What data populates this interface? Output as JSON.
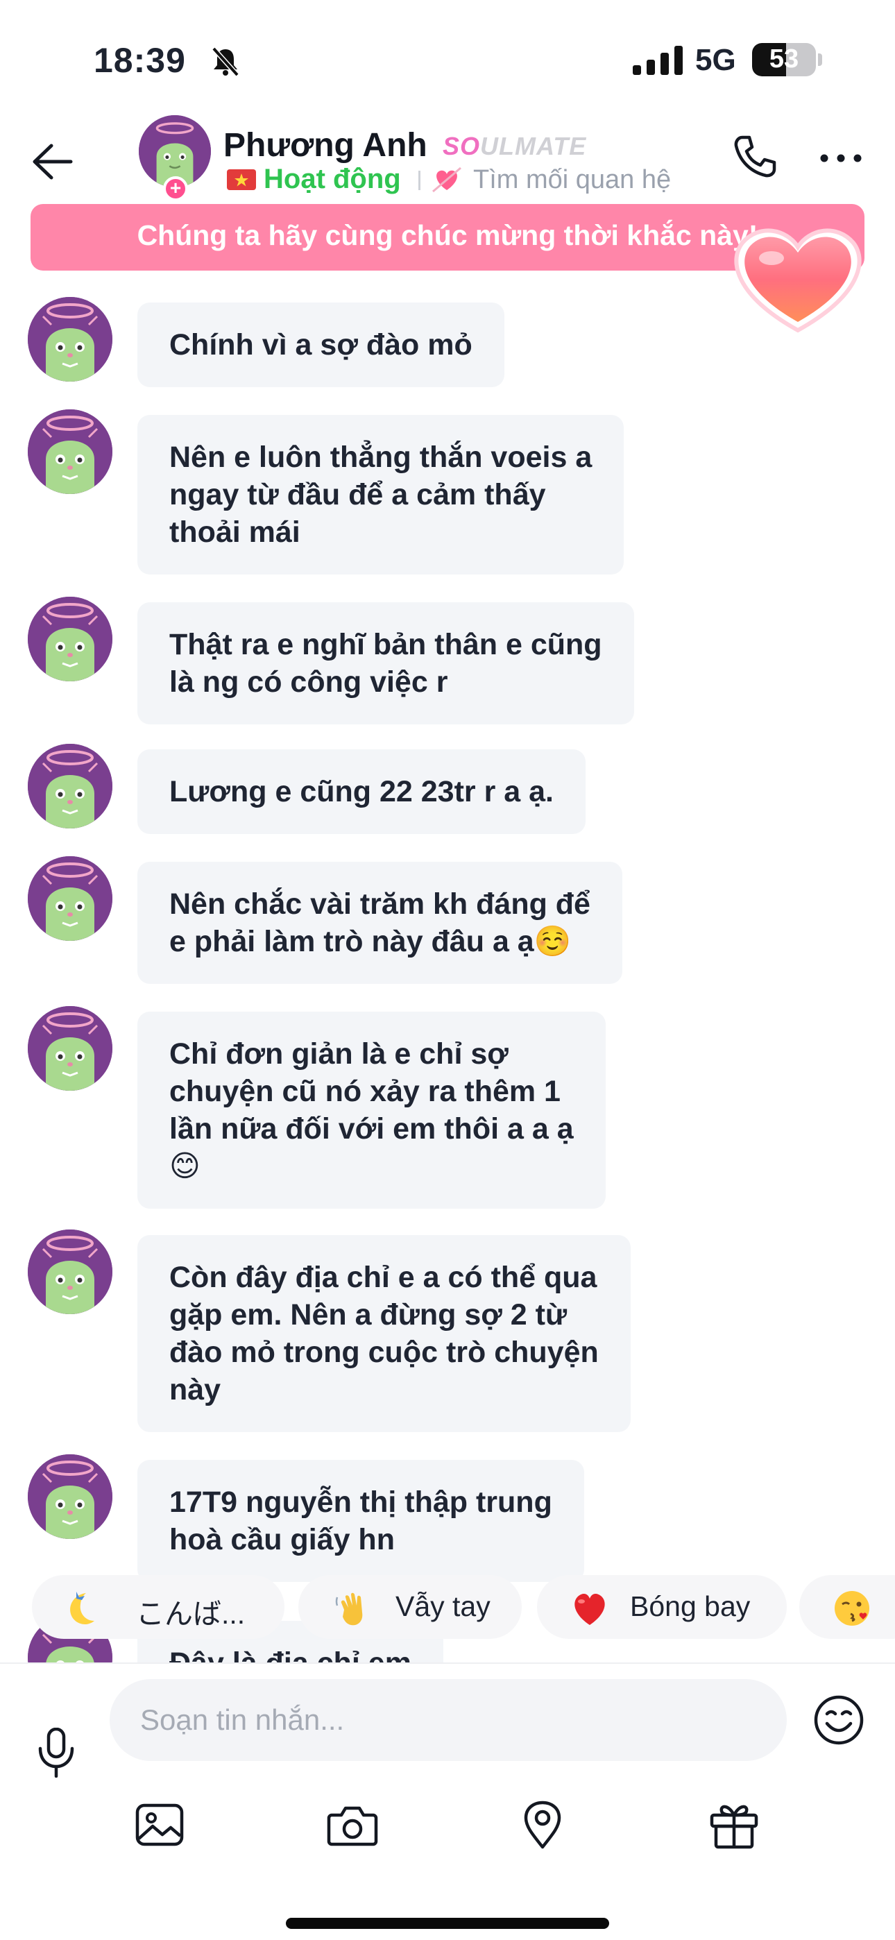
{
  "status_bar": {
    "time": "18:39",
    "network": "5G",
    "battery": "53",
    "battery_level": 0.53
  },
  "header": {
    "contact_name": "Phương Anh",
    "badge_prefix": "SO",
    "badge_suffix": "ULMATE",
    "online_status": "Hoạt động",
    "relationship_goal": "Tìm mối quan hệ"
  },
  "banner": {
    "text": "Chúng ta hãy cùng chúc mừng thời khắc này!"
  },
  "messages": [
    {
      "lines": [
        "Chính vì a sợ đào mỏ"
      ]
    },
    {
      "lines": [
        "Nên e luôn thẳng thắn voeis a",
        "ngay từ đầu để a cảm thấy",
        "thoải mái"
      ]
    },
    {
      "lines": [
        "Thật ra e nghĩ bản thân e cũng",
        "là ng có công việc r"
      ]
    },
    {
      "lines": [
        "Lương e cũng 22 23tr r a ạ."
      ]
    },
    {
      "lines": [
        "Nên chắc vài trăm kh đáng để",
        "e phải làm trò này đâu a ạ☺️"
      ]
    },
    {
      "lines": [
        "Chỉ đơn giản là e chỉ sợ",
        "chuyện cũ nó xảy ra thêm 1",
        "lần nữa đối với em thôi a a ạ",
        "😊"
      ]
    },
    {
      "lines": [
        "Còn đây địa chỉ e a có thể qua",
        "gặp em. Nên a đừng sợ 2 từ",
        "đào mỏ trong cuộc trò chuyện",
        "này"
      ]
    },
    {
      "lines": [
        "17T9 nguyễn thị thập trung",
        "hoà cầu giấy hn"
      ]
    },
    {
      "lines": [
        "Đây là địa chỉ em"
      ]
    }
  ],
  "quick_replies": [
    {
      "emoji_icon": "crescent-moon-icon",
      "label": "こんば..."
    },
    {
      "emoji_icon": "waving-hand-icon",
      "label": "Vẫy tay"
    },
    {
      "emoji_icon": "red-heart-icon",
      "label": "Bóng bay"
    },
    {
      "emoji_icon": "winking-kiss-icon",
      "label": ""
    }
  ],
  "compose": {
    "placeholder": "Soạn tin nhắn..."
  },
  "toolbar": [
    "image-icon",
    "camera-icon",
    "location-icon",
    "gift-icon"
  ],
  "colors": {
    "banner": "#ff86a9",
    "online_green": "#2fc450",
    "bubble_bg": "#f3f5f8",
    "avatar_bg": "#7a3f8f",
    "badge_pink": "#f06fc0"
  }
}
